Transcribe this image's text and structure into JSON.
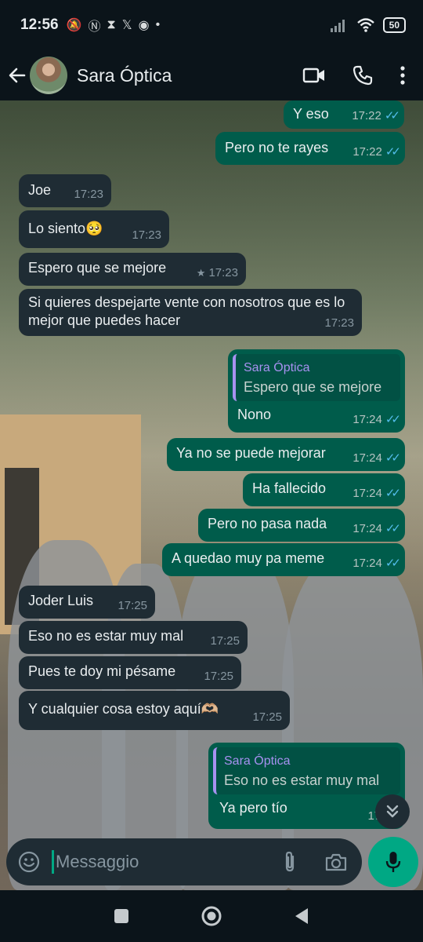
{
  "status_bar": {
    "time": "12:56",
    "battery": "50"
  },
  "header": {
    "contact_name": "Sara Óptica"
  },
  "messages": [
    {
      "text": "Y eso",
      "time": "17:22"
    },
    {
      "text": "Pero no te rayes",
      "time": "17:22"
    },
    {
      "text": "Joe",
      "time": "17:23"
    },
    {
      "text": "Lo siento🥺",
      "time": "17:23"
    },
    {
      "text": "Espero que se mejore",
      "time": "17:23"
    },
    {
      "text": "Si quieres despejarte vente con nosotros que es lo mejor que puedes hacer",
      "time": "17:23"
    },
    {
      "quote_name": "Sara Óptica",
      "quote_text": "Espero que se mejore",
      "text": "Nono",
      "time": "17:24"
    },
    {
      "text": "Ya no se puede mejorar",
      "time": "17:24"
    },
    {
      "text": "Ha fallecido",
      "time": "17:24"
    },
    {
      "text": "Pero no pasa nada",
      "time": "17:24"
    },
    {
      "text": "A quedao muy pa meme",
      "time": "17:24"
    },
    {
      "text": "Joder Luis",
      "time": "17:25"
    },
    {
      "text": "Eso no es estar muy mal",
      "time": "17:25"
    },
    {
      "text": "Pues te doy mi pésame",
      "time": "17:25"
    },
    {
      "text": "Y cualquier cosa estoy aquí🫶🏼",
      "time": "17:25"
    },
    {
      "quote_name": "Sara Óptica",
      "quote_text": "Eso no es estar muy mal",
      "text": "Ya pero tío",
      "time": "17:37"
    }
  ],
  "composer": {
    "placeholder": "Messaggio"
  },
  "icons": {
    "back": "arrow-left-icon",
    "video": "video-call-icon",
    "call": "phone-icon",
    "menu": "more-vert-icon",
    "emoji": "emoji-icon",
    "attach": "paperclip-icon",
    "camera": "camera-icon",
    "mic": "mic-icon",
    "scroll": "chevrons-down-icon"
  },
  "colors": {
    "incoming": "#1f2c34",
    "outgoing": "#005c4b",
    "accent": "#00a884",
    "read_ticks": "#53bdeb",
    "quote_name": "#a791f0"
  }
}
